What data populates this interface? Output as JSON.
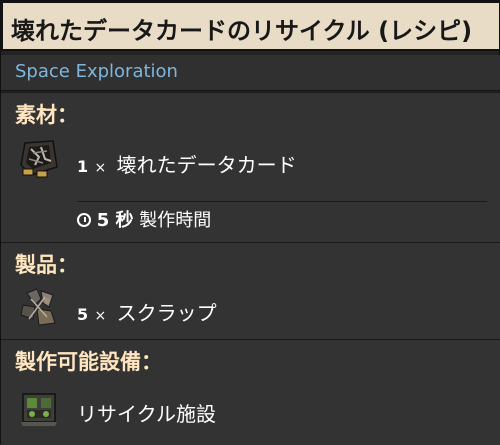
{
  "title": "壊れたデータカードのリサイクル (レシピ)",
  "mod_name": "Space Exploration",
  "ingredients": {
    "heading": "素材：",
    "items": [
      {
        "count": "1",
        "times": "×",
        "name": "壊れたデータカード",
        "icon": "broken-data-card-icon"
      }
    ],
    "time_value": "5 秒",
    "time_label": "製作時間"
  },
  "products": {
    "heading": "製品：",
    "items": [
      {
        "count": "5",
        "times": "×",
        "name": "スクラップ",
        "icon": "scrap-icon"
      }
    ]
  },
  "made_in": {
    "heading": "製作可能設備：",
    "items": [
      {
        "name": "リサイクル施設",
        "icon": "recycling-facility-icon"
      }
    ]
  },
  "colors": {
    "title_bg": "#e9dcc6",
    "section_bg": "#333333",
    "heading": "#ffe6c0",
    "mod_link": "#7fb6dc"
  }
}
